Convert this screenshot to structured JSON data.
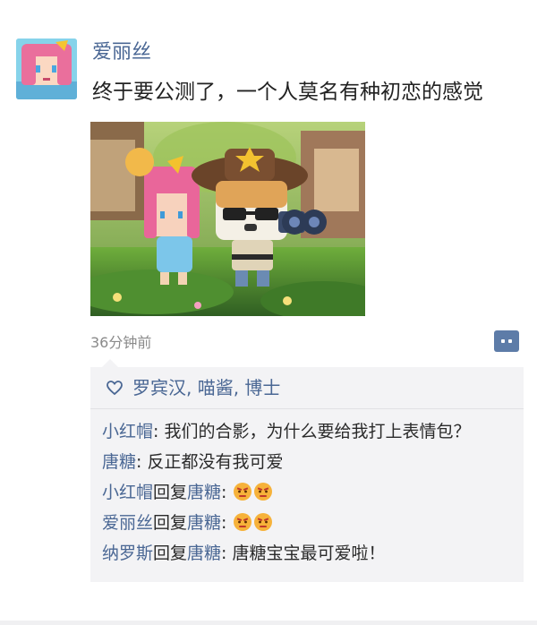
{
  "post": {
    "author": "爱丽丝",
    "text": "终于要公测了，一个人莫名有种初恋的感觉",
    "timestamp": "36分钟前"
  },
  "likes": {
    "icon": "heart-outline-icon",
    "names": "罗宾汉, 喵酱, 博士"
  },
  "comments": [
    {
      "author": "小红帽",
      "text": ": 我们的合影，为什么要给我打上表情包？"
    },
    {
      "author": "唐糖",
      "text": ": 反正都没有我可爱"
    },
    {
      "author": "小红帽",
      "reply_word": "回复",
      "reply_to": "唐糖",
      "text": ": ",
      "emoji": [
        "angry-face-emoji",
        "angry-face-emoji"
      ]
    },
    {
      "author": "爱丽丝",
      "reply_word": "回复",
      "reply_to": "唐糖",
      "text": ": ",
      "emoji": [
        "angry-face-emoji",
        "angry-face-emoji"
      ]
    },
    {
      "author": "纳罗斯",
      "reply_word": "回复",
      "reply_to": "唐糖",
      "text": ": 唐糖宝宝最可爱啦！"
    }
  ],
  "colors": {
    "link_blue": "#4a6794",
    "panel_bg": "#f3f3f5",
    "comment_button": "#5d7ca8"
  }
}
